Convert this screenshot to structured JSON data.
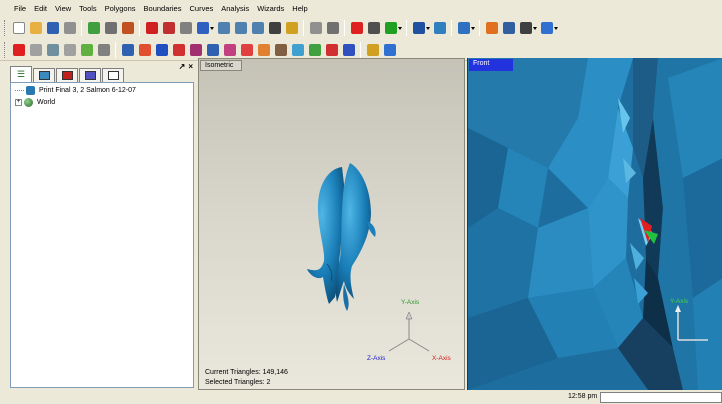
{
  "menu": [
    "File",
    "Edit",
    "View",
    "Tools",
    "Polygons",
    "Boundaries",
    "Curves",
    "Analysis",
    "Wizards",
    "Help"
  ],
  "toolbar1": [
    {
      "icon": "new-file-icon",
      "color": "#ffffff"
    },
    {
      "icon": "open-folder-icon",
      "color": "#e8b040"
    },
    {
      "icon": "save-icon",
      "color": "#3060b0"
    },
    {
      "icon": "print-icon",
      "color": "#909090"
    },
    {
      "sep": true
    },
    {
      "icon": "points-icon",
      "color": "#40a040"
    },
    {
      "icon": "cube-icon",
      "color": "#707070"
    },
    {
      "icon": "layers-icon",
      "color": "#c05020"
    },
    {
      "sep": true
    },
    {
      "icon": "target-icon",
      "color": "#d02020"
    },
    {
      "icon": "target-alt-icon",
      "color": "#c03030"
    },
    {
      "icon": "gear-icon",
      "color": "#808080"
    },
    {
      "icon": "rotate-icon",
      "color": "#3060c0",
      "caret": true
    },
    {
      "icon": "zoom-in-icon",
      "color": "#5080b0"
    },
    {
      "icon": "zoom-out-icon",
      "color": "#5080b0"
    },
    {
      "icon": "zoom-fit-icon",
      "color": "#5080b0"
    },
    {
      "icon": "camera-icon",
      "color": "#404040"
    },
    {
      "icon": "pencil-icon",
      "color": "#d0a020"
    },
    {
      "sep": true
    },
    {
      "icon": "brush-icon",
      "color": "#909090"
    },
    {
      "icon": "grid-icon",
      "color": "#707070"
    },
    {
      "sep": true
    },
    {
      "icon": "record-icon",
      "color": "#e02020"
    },
    {
      "icon": "stop-icon",
      "color": "#505050"
    },
    {
      "icon": "play-icon",
      "color": "#20a020",
      "caret": true
    },
    {
      "sep": true
    },
    {
      "icon": "gradient-icon",
      "color": "#2050a0",
      "caret": true
    },
    {
      "icon": "box-icon",
      "color": "#3080c0"
    },
    {
      "sep": true
    },
    {
      "icon": "window-icon",
      "color": "#3070c0",
      "caret": true
    },
    {
      "sep": true
    },
    {
      "icon": "select-icon",
      "color": "#e07020"
    },
    {
      "icon": "lasso-icon",
      "color": "#3060a0"
    },
    {
      "icon": "rect-select-icon",
      "color": "#404040",
      "caret": true
    },
    {
      "icon": "magic-icon",
      "color": "#3070d0",
      "caret": true
    }
  ],
  "toolbar2": [
    {
      "icon": "delete-icon",
      "color": "#e02020"
    },
    {
      "icon": "move-icon",
      "color": "#a0a0a0"
    },
    {
      "icon": "globe-icon",
      "color": "#7090a0"
    },
    {
      "icon": "mesh-icon",
      "color": "#a0a0a0"
    },
    {
      "icon": "shapes-icon",
      "color": "#60b040"
    },
    {
      "icon": "tools-icon",
      "color": "#808080"
    },
    {
      "sep": true
    },
    {
      "icon": "fill-icon",
      "color": "#3060b0"
    },
    {
      "icon": "surface-icon",
      "color": "#e05030"
    },
    {
      "icon": "sphere-icon",
      "color": "#2050c0"
    },
    {
      "icon": "torus-icon",
      "color": "#d03030"
    },
    {
      "icon": "edit-mesh-icon",
      "color": "#a03070"
    },
    {
      "icon": "smooth-icon",
      "color": "#3060b0"
    },
    {
      "icon": "sculpt-icon",
      "color": "#c04080"
    },
    {
      "icon": "relax-icon",
      "color": "#e04040"
    },
    {
      "icon": "decimate-icon",
      "color": "#e08030"
    },
    {
      "icon": "offset-icon",
      "color": "#806040"
    },
    {
      "icon": "cone-icon",
      "color": "#40a0d0"
    },
    {
      "icon": "pyramid-icon",
      "color": "#40a040"
    },
    {
      "icon": "fill-holes-icon",
      "color": "#d03030"
    },
    {
      "icon": "shell-icon",
      "color": "#3050c0"
    },
    {
      "sep": true
    },
    {
      "icon": "layers-stack-icon",
      "color": "#d0a020"
    },
    {
      "icon": "wave-icon",
      "color": "#3070d0"
    }
  ],
  "tree": {
    "items": [
      {
        "label": "Print Final 3, 2 Salmon 6-12-07",
        "icon_color": "#2a78b0"
      },
      {
        "label": "World",
        "icon_color": "#3a8a3a"
      }
    ]
  },
  "iso": {
    "label": "Isometric",
    "triangles": "Current Triangles: 149,146",
    "selected": "Selected Triangles: 2",
    "axes": {
      "y": "Y-Axis",
      "z": "Z-Axis",
      "x": "X-Axis"
    }
  },
  "front": {
    "label": "Front",
    "axis": "Y-Axis"
  },
  "status": {
    "clock": "12:58 pm"
  }
}
